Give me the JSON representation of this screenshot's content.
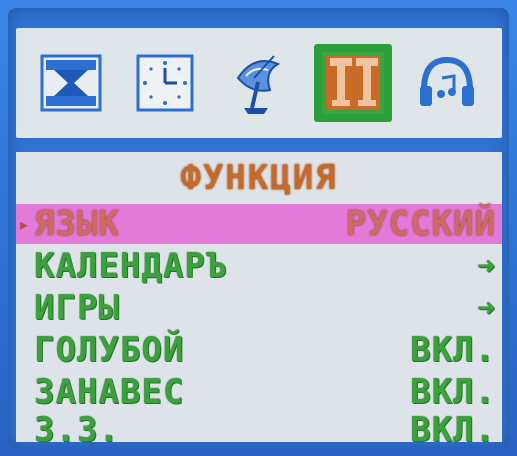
{
  "icons": [
    {
      "name": "hourglass-icon",
      "selected": false
    },
    {
      "name": "clock-icon",
      "selected": false
    },
    {
      "name": "satellite-dish-icon",
      "selected": false
    },
    {
      "name": "tools-icon",
      "selected": true
    },
    {
      "name": "headphones-icon",
      "selected": false
    }
  ],
  "menu": {
    "title": "ФУНКЦИЯ",
    "rows": [
      {
        "label": "ЯЗЫК",
        "value": "РУССКИЙ",
        "highlighted": true
      },
      {
        "label": "КАЛЕНДАРЪ",
        "value": "➜",
        "highlighted": false
      },
      {
        "label": "ИГРЫ",
        "value": "➜",
        "highlighted": false
      },
      {
        "label": "ГОЛУБОЙ",
        "value": "ВКЛ.",
        "highlighted": false
      },
      {
        "label": "ЗАНАВЕС",
        "value": "ВКЛ.",
        "highlighted": false
      },
      {
        "label": "З.З.",
        "value": "ВКЛ.",
        "highlighted": false
      }
    ]
  },
  "colors": {
    "background": "#2f78d8",
    "panel": "#dde3e8",
    "highlight": "#e27ad8",
    "text_green": "#3aa13c",
    "title_orange": "#c66a2c",
    "selected_icon_bg": "#2b9f3a"
  }
}
